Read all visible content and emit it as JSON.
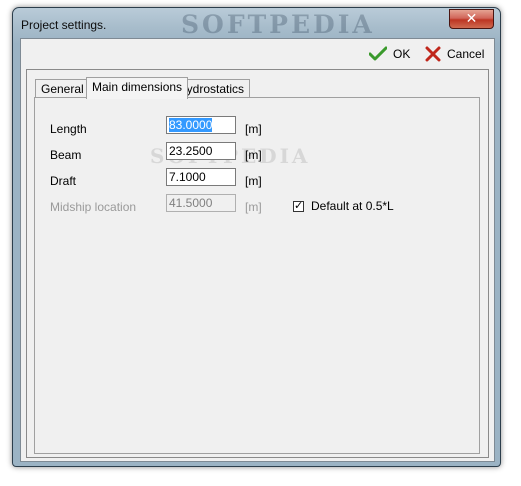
{
  "window": {
    "title": "Project settings.",
    "close_glyph": "✕",
    "watermark": "SOFTPEDIA"
  },
  "toolbar": {
    "ok_label": "OK",
    "cancel_label": "Cancel",
    "ok_icon": "checkmark-icon",
    "cancel_icon": "x-cancel-icon"
  },
  "tabs": [
    {
      "label": "General",
      "active": false
    },
    {
      "label": "Main dimensions",
      "active": true
    },
    {
      "label": "Hydrostatics",
      "active": false
    }
  ],
  "fields": {
    "length": {
      "label": "Length",
      "value": "83.0000",
      "unit": "[m]"
    },
    "beam": {
      "label": "Beam",
      "value": "23.2500",
      "unit": "[m]"
    },
    "draft": {
      "label": "Draft",
      "value": "7.1000",
      "unit": "[m]"
    },
    "midship": {
      "label": "Midship location",
      "value": "41.5000",
      "unit": "[m]"
    }
  },
  "checkbox": {
    "label": "Default at 0.5*L",
    "checked": true,
    "check_glyph": "✓"
  },
  "colors": {
    "ok_green": "#3a9a2c",
    "cancel_red": "#c0261b",
    "selection": "#3399ff"
  }
}
